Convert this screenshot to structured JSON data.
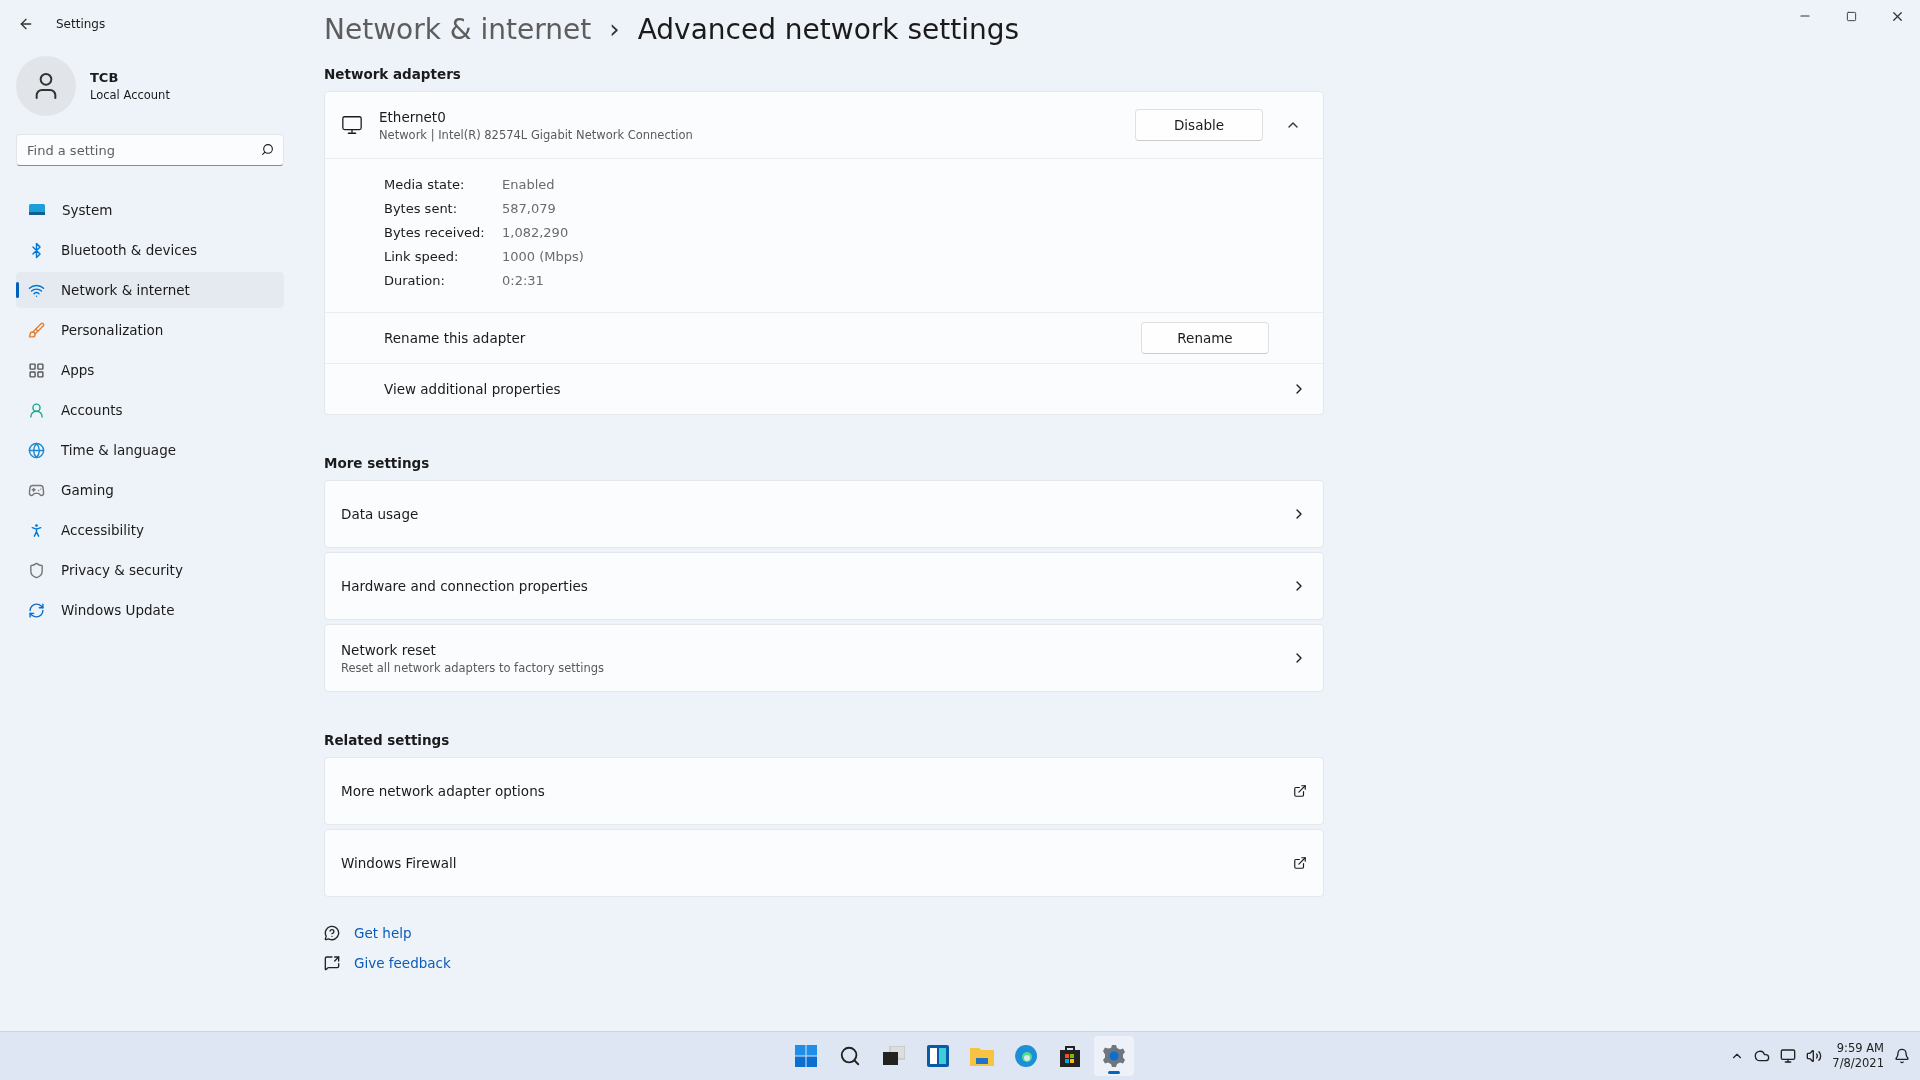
{
  "window": {
    "title": "Settings"
  },
  "account": {
    "name": "TCB",
    "type": "Local Account"
  },
  "search": {
    "placeholder": "Find a setting"
  },
  "nav": [
    {
      "label": "System",
      "selected": false
    },
    {
      "label": "Bluetooth & devices",
      "selected": false
    },
    {
      "label": "Network & internet",
      "selected": true
    },
    {
      "label": "Personalization",
      "selected": false
    },
    {
      "label": "Apps",
      "selected": false
    },
    {
      "label": "Accounts",
      "selected": false
    },
    {
      "label": "Time & language",
      "selected": false
    },
    {
      "label": "Gaming",
      "selected": false
    },
    {
      "label": "Accessibility",
      "selected": false
    },
    {
      "label": "Privacy & security",
      "selected": false
    },
    {
      "label": "Windows Update",
      "selected": false
    }
  ],
  "breadcrumb": {
    "parent": "Network & internet",
    "separator": "›",
    "current": "Advanced network settings"
  },
  "adapters": {
    "heading": "Network adapters",
    "name": "Ethernet0",
    "description": "Network | Intel(R) 82574L Gigabit Network Connection",
    "button": "Disable",
    "expanded": true,
    "properties": [
      {
        "label": "Media state:",
        "value": "Enabled"
      },
      {
        "label": "Bytes sent:",
        "value": "587,079"
      },
      {
        "label": "Bytes received:",
        "value": "1,082,290"
      },
      {
        "label": "Link speed:",
        "value": "1000 (Mbps)"
      },
      {
        "label": "Duration:",
        "value": "0:2:31"
      }
    ],
    "rename": {
      "label": "Rename this adapter",
      "button": "Rename"
    },
    "more": {
      "label": "View additional properties"
    }
  },
  "sections": [
    {
      "heading": "More settings",
      "items": [
        {
          "title": "Data usage",
          "kind": "chevron"
        },
        {
          "title": "Hardware and connection properties",
          "kind": "chevron"
        },
        {
          "title": "Network reset",
          "subtitle": "Reset all network adapters to factory settings",
          "kind": "chevron"
        }
      ]
    },
    {
      "heading": "Related settings",
      "items": [
        {
          "title": "More network adapter options",
          "kind": "external"
        },
        {
          "title": "Windows Firewall",
          "kind": "external"
        }
      ]
    }
  ],
  "help_links": [
    {
      "label": "Get help",
      "kind": "help"
    },
    {
      "label": "Give feedback",
      "kind": "feedback"
    }
  ],
  "taskbar": {
    "apps": [
      {
        "kind": "start",
        "selected": false
      },
      {
        "kind": "search",
        "selected": false
      },
      {
        "kind": "taskview",
        "selected": false
      },
      {
        "kind": "widgets",
        "selected": false
      },
      {
        "kind": "explorer",
        "selected": false
      },
      {
        "kind": "browser",
        "selected": false
      },
      {
        "kind": "store",
        "selected": false
      },
      {
        "kind": "settings",
        "selected": true
      }
    ],
    "time": "9:59 AM",
    "date": "7/8/2021"
  }
}
